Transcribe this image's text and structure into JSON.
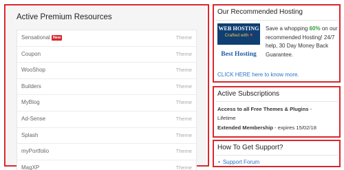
{
  "resources": {
    "title": "Active Premium Resources",
    "items": [
      {
        "name": "Sensational",
        "badge": "New",
        "kind": "Theme"
      },
      {
        "name": "Coupon",
        "badge": "",
        "kind": "Theme"
      },
      {
        "name": "WooShop",
        "badge": "",
        "kind": "Theme"
      },
      {
        "name": "Builders",
        "badge": "",
        "kind": "Theme"
      },
      {
        "name": "MyBlog",
        "badge": "",
        "kind": "Theme"
      },
      {
        "name": "Ad-Sense",
        "badge": "",
        "kind": "Theme"
      },
      {
        "name": "Splash",
        "badge": "",
        "kind": "Theme"
      },
      {
        "name": "myPortfolio",
        "badge": "",
        "kind": "Theme"
      },
      {
        "name": "MagXP",
        "badge": "",
        "kind": "Theme"
      }
    ]
  },
  "hosting": {
    "title": "Our Recommended Hosting",
    "ad_line1": "WEB HOSTING",
    "ad_line2": "Crafted with",
    "ad_heart": "♥",
    "ad_brand": "Best Hosting",
    "text_pre": "Save a whopping ",
    "text_highlight": "60%",
    "text_post": " on our recommended Hosting! 24/7 help, 30 Day Money Back Guarantee.",
    "link": "CLICK HERE here to know more."
  },
  "subscriptions": {
    "title": "Active Subscriptions",
    "line1_bold": "Access to all Free Themes & Plugins",
    "line1_rest": " -",
    "line2": "Lifetime",
    "line3_bold": "Extended Membership",
    "line3_rest": " - expires 15/02/18"
  },
  "support": {
    "title": "How To Get Support?",
    "bullet": "•",
    "link": "Support Forum"
  },
  "colors": {
    "highlight_border": "#d9262c",
    "link": "#2a73c8",
    "accent_green": "#2e9e3d"
  }
}
